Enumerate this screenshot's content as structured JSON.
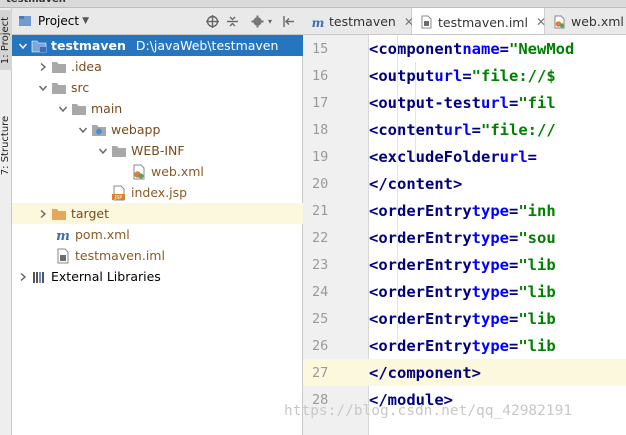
{
  "window": {
    "title": "testmaven"
  },
  "left_strip": {
    "project_label": "1: Project",
    "structure_label": "7: Structure"
  },
  "project_panel": {
    "title": "Project",
    "tree": [
      {
        "label": "testmaven",
        "path": "D:\\javaWeb\\testmaven",
        "icon": "module-folder-icon",
        "expanded": true,
        "selected": true
      },
      {
        "label": ".idea",
        "icon": "folder-icon",
        "expanded": false
      },
      {
        "label": "src",
        "icon": "folder-icon",
        "expanded": true
      },
      {
        "label": "main",
        "icon": "folder-icon",
        "expanded": true
      },
      {
        "label": "webapp",
        "icon": "web-folder-icon",
        "expanded": true
      },
      {
        "label": "WEB-INF",
        "icon": "folder-icon",
        "expanded": true
      },
      {
        "label": "web.xml",
        "icon": "web-xml-icon"
      },
      {
        "label": "index.jsp",
        "icon": "jsp-file-icon"
      },
      {
        "label": "target",
        "icon": "excluded-folder-icon",
        "expanded": false
      },
      {
        "label": "pom.xml",
        "icon": "maven-icon"
      },
      {
        "label": "testmaven.iml",
        "icon": "iml-file-icon"
      },
      {
        "label": "External Libraries",
        "icon": "library-icon",
        "expanded": false
      }
    ]
  },
  "tabs": [
    {
      "label": "testmaven",
      "icon": "maven-icon",
      "active": false
    },
    {
      "label": "testmaven.iml",
      "icon": "iml-file-icon",
      "active": true
    },
    {
      "label": "web.xml",
      "icon": "web-xml-icon",
      "active": false
    }
  ],
  "editor": {
    "current_line": 27,
    "lines": [
      {
        "number": "15",
        "text": "<component name=\"NewMod"
      },
      {
        "number": "16",
        "text": "  <output url=\"file://$"
      },
      {
        "number": "17",
        "text": "  <output-test url=\"fil"
      },
      {
        "number": "18",
        "text": "  <content url=\"file://"
      },
      {
        "number": "19",
        "text": "    <excludeFolder url="
      },
      {
        "number": "20",
        "text": "  </content>"
      },
      {
        "number": "21",
        "text": "  <orderEntry type=\"inh"
      },
      {
        "number": "22",
        "text": "  <orderEntry type=\"sou"
      },
      {
        "number": "23",
        "text": "  <orderEntry type=\"lib"
      },
      {
        "number": "24",
        "text": "  <orderEntry type=\"lib"
      },
      {
        "number": "25",
        "text": "  <orderEntry type=\"lib"
      },
      {
        "number": "26",
        "text": "  <orderEntry type=\"lib"
      },
      {
        "number": "27",
        "text": "</component>"
      },
      {
        "number": "28",
        "text": "</module>"
      }
    ]
  },
  "watermark": "https://blog.csdn.net/qq_42982191",
  "colors": {
    "selection": "#2675bf",
    "current_line": "#fbf8dd",
    "tag": "#000080",
    "attribute": "#0000ff",
    "string": "#008000"
  }
}
